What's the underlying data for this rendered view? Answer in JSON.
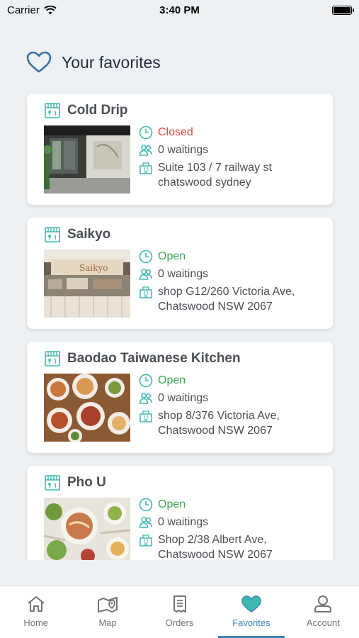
{
  "status_bar": {
    "carrier": "Carrier",
    "time": "3:40 PM"
  },
  "header": {
    "title": "Your favorites",
    "icon": "heart-outline-icon"
  },
  "colors": {
    "accent": "#3a86b9",
    "closed": "#e5453c",
    "open": "#3aa64f",
    "icon_teal": "#3fb8b0"
  },
  "favorites": [
    {
      "name": "Cold Drip",
      "status": "Closed",
      "status_type": "closed",
      "waitings": "0 waitings",
      "address": "Suite 103 / 7 railway st chatswood sydney"
    },
    {
      "name": "Saikyo",
      "status": "Open",
      "status_type": "open",
      "waitings": "0 waitings",
      "address": "shop G12/260 Victoria Ave, Chatswood NSW 2067"
    },
    {
      "name": "Baodao Taiwanese Kitchen",
      "status": "Open",
      "status_type": "open",
      "waitings": "0 waitings",
      "address": "shop 8/376 Victoria Ave, Chatswood NSW 2067"
    },
    {
      "name": "Pho U",
      "status": "Open",
      "status_type": "open",
      "waitings": "0 waitings",
      "address": "Shop 2/38 Albert Ave, Chatswood NSW 2067"
    }
  ],
  "tabs": [
    {
      "label": "Home",
      "icon": "home-icon"
    },
    {
      "label": "Map",
      "icon": "map-icon"
    },
    {
      "label": "Orders",
      "icon": "receipt-icon"
    },
    {
      "label": "Favorites",
      "icon": "heart-icon",
      "active": true
    },
    {
      "label": "Account",
      "icon": "account-icon"
    }
  ]
}
